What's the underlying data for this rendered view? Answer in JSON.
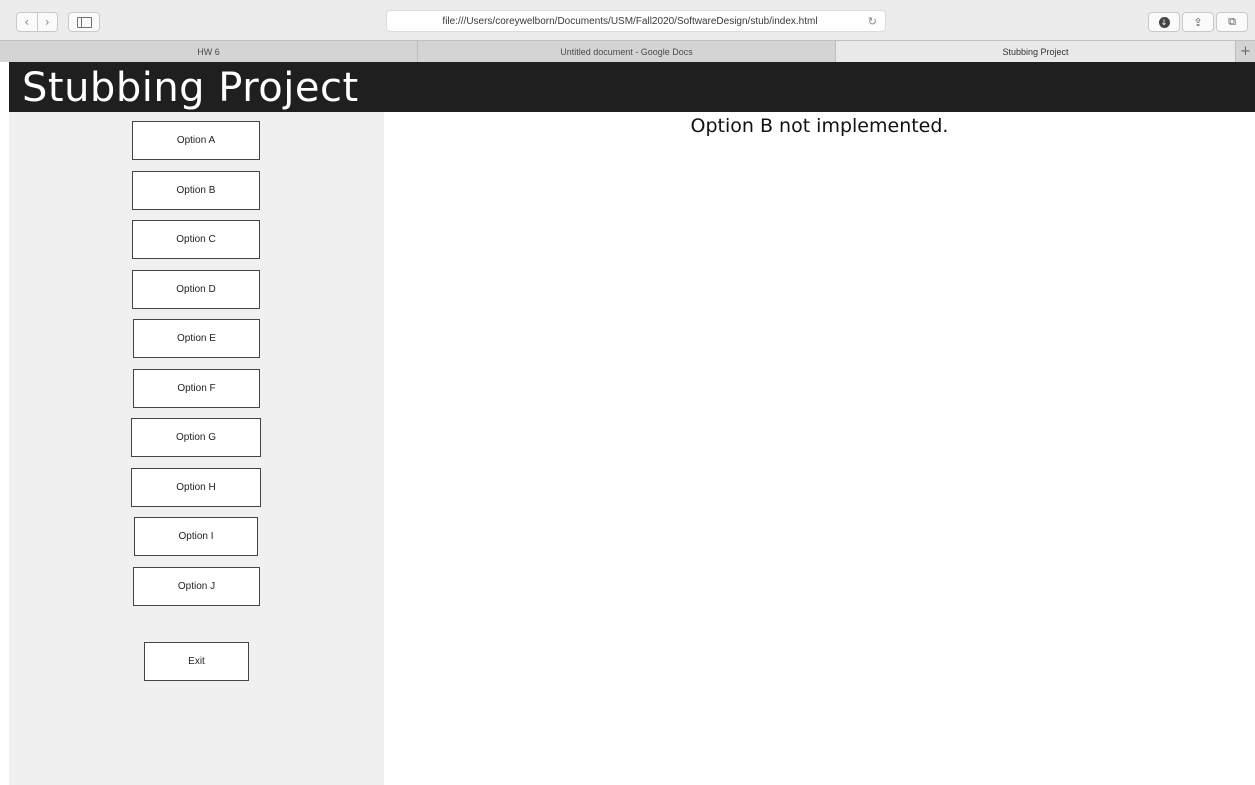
{
  "browser": {
    "url": "file:///Users/coreywelborn/Documents/USM/Fall2020/SoftwareDesign/stub/index.html",
    "tabs": [
      "HW 6",
      "Untitled document - Google Docs",
      "Stubbing Project"
    ],
    "active_tab": "Stubbing Project",
    "icons": {
      "back": "back-icon",
      "forward": "forward-icon",
      "sidebar": "sidebar-icon",
      "reload": "reload-icon",
      "download": "download-icon",
      "share": "share-icon",
      "tabs": "tabs-overview-icon",
      "new_tab": "plus-icon"
    }
  },
  "page": {
    "title": "Stubbing Project",
    "message": "Option B not implemented.",
    "options": [
      "Option A",
      "Option B",
      "Option C",
      "Option D",
      "Option E",
      "Option F",
      "Option G",
      "Option H",
      "Option I",
      "Option J"
    ],
    "exit_label": "Exit"
  },
  "colors": {
    "header_bg": "#1f1f1f",
    "header_text": "#ffffff",
    "sidebar_bg": "#f0f0f0",
    "button_border": "#444444"
  }
}
